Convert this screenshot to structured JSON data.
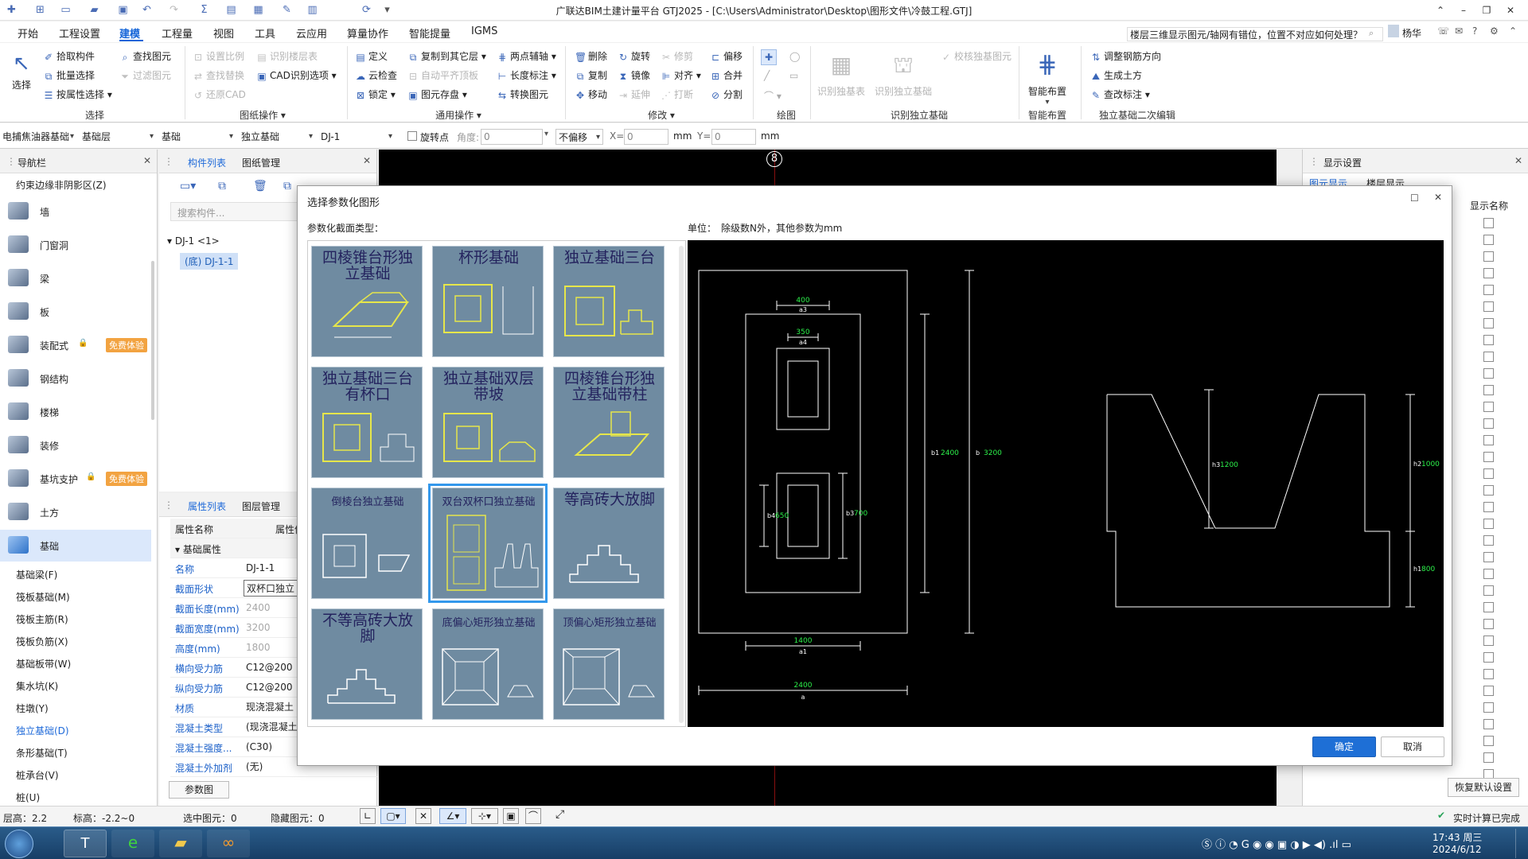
{
  "titlebar": {
    "title": "广联达BIM土建计量平台 GTJ2025 - [C:\\Users\\Administrator\\Desktop\\图形文件\\冷鼓工程.GTJ]"
  },
  "menubar": {
    "tabs": [
      "开始",
      "工程设置",
      "建模",
      "工程量",
      "视图",
      "工具",
      "云应用",
      "算量协作",
      "智能提量",
      "IGMS"
    ],
    "active_tab": "建模",
    "help_query": "楼层三维显示图元/轴网有错位，位置不对应如何处理？",
    "user": "杨华"
  },
  "ribbon": {
    "select": {
      "big": "选择",
      "items": [
        "拾取构件",
        "批量选择",
        "按属性选择"
      ],
      "group": "选择"
    },
    "find": {
      "items": [
        "查找图元",
        "过滤图元"
      ]
    },
    "drawing_ops": {
      "items": [
        "设置比例",
        "识别楼层表",
        "查找替换",
        "CAD识别选项",
        "还原CAD"
      ],
      "group": "图纸操作"
    },
    "general_ops": {
      "items": [
        "定义",
        "复制到其它层",
        "两点辅轴",
        "云检查",
        "自动平齐顶板",
        "长度标注",
        "锁定",
        "图元存盘",
        "转换图元"
      ],
      "group": "通用操作"
    },
    "modify": {
      "items": [
        "删除",
        "旋转",
        "修剪",
        "偏移",
        "复制",
        "镜像",
        "对齐",
        "合并",
        "移动",
        "延伸",
        "打断",
        "分割"
      ],
      "group": "修改"
    },
    "draw": {
      "group": "绘图"
    },
    "recognize": {
      "items": [
        "识别独基表",
        "识别独立基础",
        "校核独基图元"
      ],
      "group": "识别独立基础"
    },
    "smart": {
      "big": "智能布置",
      "group": "智能布置"
    },
    "secondary": {
      "items": [
        "调整钢筋方向",
        "生成土方",
        "查改标注"
      ],
      "group": "独立基础二次编辑"
    }
  },
  "filterbar": {
    "selects": [
      "电捕焦油器基础",
      "基础层",
      "基础",
      "独立基础",
      "DJ-1"
    ],
    "rotate_point": "旋转点",
    "angle_label": "角度:",
    "angle_value": "0",
    "offset_mode": "不偏移",
    "x_label": "X=",
    "x_value": "0",
    "y_label": "Y=",
    "y_value": "0",
    "unit": "mm"
  },
  "nav": {
    "title": "导航栏",
    "top_item": "约束边缘非阴影区(Z)",
    "categories": [
      {
        "label": "墙",
        "badge": ""
      },
      {
        "label": "门窗洞",
        "badge": ""
      },
      {
        "label": "梁",
        "badge": ""
      },
      {
        "label": "板",
        "badge": ""
      },
      {
        "label": "装配式",
        "badge": "免费体验"
      },
      {
        "label": "钢结构",
        "badge": ""
      },
      {
        "label": "楼梯",
        "badge": ""
      },
      {
        "label": "装修",
        "badge": ""
      },
      {
        "label": "基坑支护",
        "badge": "免费体验"
      },
      {
        "label": "土方",
        "badge": ""
      },
      {
        "label": "基础",
        "badge": ""
      }
    ],
    "active_category": "基础",
    "subitems": [
      "基础梁(F)",
      "筏板基础(M)",
      "筏板主筋(R)",
      "筏板负筋(X)",
      "基础板带(W)",
      "集水坑(K)",
      "柱墩(Y)",
      "独立基础(D)",
      "条形基础(T)",
      "桩承台(V)",
      "桩(U)"
    ],
    "active_subitem": "独立基础(D)"
  },
  "complist": {
    "tabs": [
      "构件列表",
      "图纸管理"
    ],
    "search_placeholder": "搜索构件...",
    "tree_root": "DJ-1 <1>",
    "tree_child": "(底) DJ-1-1"
  },
  "props": {
    "tabs": [
      "属性列表",
      "图层管理"
    ],
    "header_name": "属性名称",
    "header_value": "属性值",
    "group": "基础属性",
    "rows": [
      {
        "name": "名称",
        "value": "DJ-1-1"
      },
      {
        "name": "截面形状",
        "value": "双杯口独立"
      },
      {
        "name": "截面长度(mm)",
        "value": "2400"
      },
      {
        "name": "截面宽度(mm)",
        "value": "3200"
      },
      {
        "name": "高度(mm)",
        "value": "1800"
      },
      {
        "name": "横向受力筋",
        "value": "C12@200"
      },
      {
        "name": "纵向受力筋",
        "value": "C12@200"
      },
      {
        "name": "材质",
        "value": "现浇混凝土"
      },
      {
        "name": "混凝土类型",
        "value": "(现浇混凝土)"
      },
      {
        "name": "混凝土强度...",
        "value": "(C30)"
      },
      {
        "name": "混凝土外加剂",
        "value": "(无)"
      }
    ],
    "param_button": "参数图"
  },
  "rightpanel": {
    "title": "显示设置",
    "tabs": [
      "图元显示",
      "楼层显示"
    ],
    "col_header": "显示名称",
    "restore_button": "恢复默认设置"
  },
  "statusbar": {
    "floor_height": "层高：2.2",
    "elevation": "标高：-2.2~0",
    "selected": "选中图元：0",
    "hidden": "隐藏图元：0",
    "calc_status": "实时计算已完成"
  },
  "canvas": {
    "axis_label": "8"
  },
  "dialog": {
    "title": "选择参数化图形",
    "section_label": "参数化截面类型：",
    "unit_label": "单位：",
    "unit_text": "除级数N外，其他参数为mm",
    "thumbnails": [
      "四棱锥台形独立基础",
      "杯形基础",
      "独立基础三台",
      "独立基础三台有杯口",
      "独立基础双层带坡",
      "四棱锥台形独立基础带柱",
      "倒棱台独立基础",
      "双台双杯口独立基础",
      "等高砖大放脚",
      "不等高砖大放脚",
      "底偏心矩形独立基础",
      "顶偏心矩形独立基础"
    ],
    "selected_index": 7,
    "ok_button": "确定",
    "cancel_button": "取消",
    "dims": {
      "a3": "400",
      "a4": "350",
      "a1": "1400",
      "a": "2400",
      "b1": "2400",
      "b": "3200",
      "b4": "650",
      "b3": "700",
      "h3": "1200",
      "h2": "1000",
      "h1": "800",
      "a3_label": "a3",
      "a4_label": "a4",
      "a1_label": "a1",
      "a_label": "a",
      "b1_label": "b1",
      "b_label": "b",
      "b4_label": "b4",
      "b3_label": "b3",
      "h3_label": "h3",
      "h2_label": "h2",
      "h1_label": "h1"
    }
  },
  "taskbar": {
    "time": "17:43 周三",
    "date": "2024/6/12"
  }
}
